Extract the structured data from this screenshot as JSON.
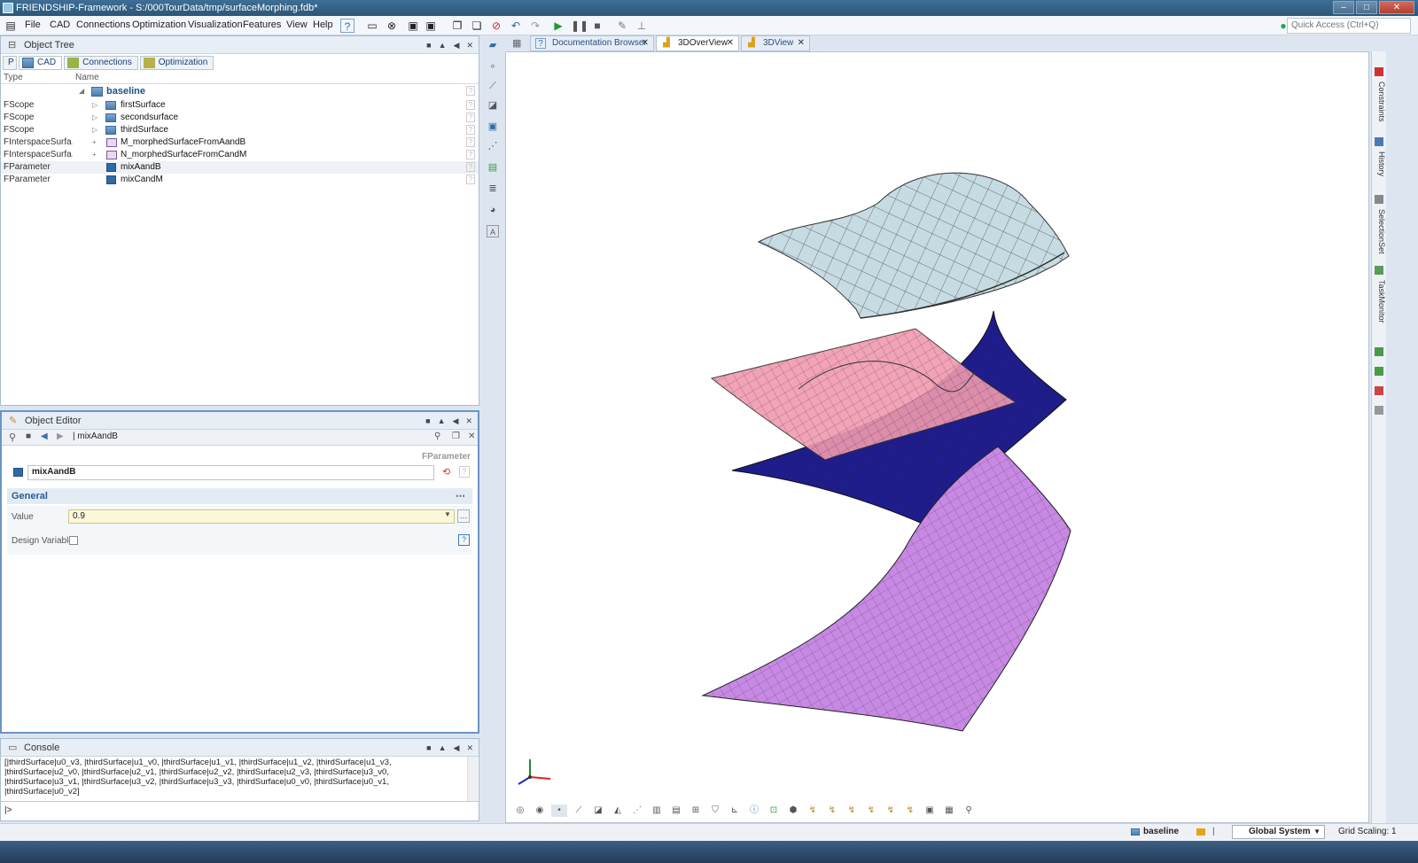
{
  "window": {
    "title": "FRIENDSHIP-Framework - S:/000TourData/tmp/surfaceMorphing.fdb*"
  },
  "menu": [
    "File",
    "CAD",
    "Connections",
    "Optimization",
    "Visualization",
    "Features",
    "View",
    "Help"
  ],
  "quick_access": {
    "placeholder": "Quick Access (Ctrl+Q)"
  },
  "object_tree": {
    "title": "Object Tree",
    "tabs": [
      "CAD",
      "Connections",
      "Optimization"
    ],
    "col_type": "Type",
    "col_name": "Name",
    "root": "baseline",
    "rows": [
      {
        "type": "FScope",
        "name": "firstSurface"
      },
      {
        "type": "FScope",
        "name": "secondsurface"
      },
      {
        "type": "FScope",
        "name": "thirdSurface"
      },
      {
        "type": "FInterspaceSurfa...",
        "name": "M_morphedSurfaceFromAandB"
      },
      {
        "type": "FInterspaceSurfa...",
        "name": "N_morphedSurfaceFromCandM"
      },
      {
        "type": "FParameter",
        "name": "mixAandB"
      },
      {
        "type": "FParameter",
        "name": "mixCandM"
      }
    ]
  },
  "object_editor": {
    "title": "Object Editor",
    "nav_label": "| mixAandB",
    "kind": "FParameter",
    "name": "mixAandB",
    "section": "General",
    "value_label": "Value",
    "value": "0.9",
    "design_variable_label": "Design Variable"
  },
  "console": {
    "title": "Console",
    "text": "[|thirdSurface|u0_v3, |thirdSurface|u1_v0, |thirdSurface|u1_v1, |thirdSurface|u1_v2, |thirdSurface|u1_v3, |thirdSurface|u2_v0, |thirdSurface|u2_v1, |thirdSurface|u2_v2, |thirdSurface|u2_v3, |thirdSurface|u3_v0, |thirdSurface|u3_v1, |thirdSurface|u3_v2, |thirdSurface|u3_v3, |thirdSurface|u0_v0, |thirdSurface|u0_v1, |thirdSurface|u0_v2]",
    "prompt": "|>"
  },
  "view_tabs": [
    "Documentation Browser",
    "3DOverView",
    "3DView"
  ],
  "right_tabs": [
    "Constraints",
    "History",
    "SelectionSet",
    "TaskMonitor"
  ],
  "status": {
    "scope": "baseline",
    "system": "Global System",
    "grid": "Grid Scaling: 1"
  },
  "colors": {
    "accent": "#2e6aa8",
    "surface_top": "#c9dde3",
    "surface_pink": "#f08aa0",
    "surface_blue": "#1d1b8a",
    "surface_violet": "#c788e3"
  }
}
